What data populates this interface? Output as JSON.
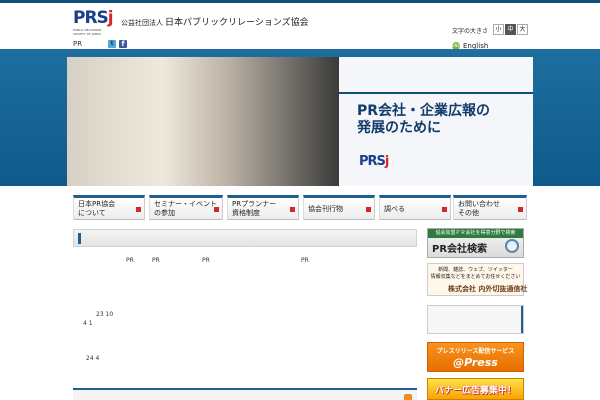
{
  "header": {
    "logo_text": "PRS",
    "logo_accent": "j",
    "logo_sub": "PUBLIC RELATIONS SOCIETY OF JAPAN",
    "org_prefix": "公益社団法人",
    "org_name": "日本パブリックリレーションズ協会",
    "pr_link": "PR",
    "twitter_glyph": "t",
    "facebook_glyph": "f"
  },
  "font_size": {
    "label": "文字の大きさ",
    "options": [
      "小",
      "中",
      "大"
    ],
    "selected": "中"
  },
  "language": {
    "icon_label": "ENG",
    "label": "English"
  },
  "hero": {
    "title_line1": "PR会社・企業広報の",
    "title_line2": "発展のために",
    "logo_text": "PRS",
    "logo_accent": "j"
  },
  "nav": [
    {
      "label": "日本PR協会\nについて"
    },
    {
      "label": "セミナー・イベント\nの参加"
    },
    {
      "label": "PRプランナー\n資格制度"
    },
    {
      "label": "協会刊行物"
    },
    {
      "label": "調べる"
    },
    {
      "label": "お問い合わせ\nその他"
    }
  ],
  "main": {
    "pr_1": "PR",
    "pr_2": "PR",
    "pr_3": "PR",
    "pr_4": "PR",
    "date_1": "23 10",
    "date_2": "4 1",
    "date_3": "24 4"
  },
  "sidebar": {
    "search_top": "協会加盟ＰＲ会社を得意分野で検索",
    "search_main": "PR会社検索",
    "clipping_text": "新聞、雑誌、ウェブ、ツイッター\n情報収集などをまとめてお任せください",
    "clipping_logo": "株式会社 内外切抜通信社",
    "press_top": "プレスリリース配信サービス",
    "press_main": "@Press",
    "banner_text": "バナー広告募集中！"
  },
  "colors": {
    "accent_blue": "#1d5f8d",
    "brand_red": "#d6272c",
    "hero_band": "#1e6ea0"
  }
}
